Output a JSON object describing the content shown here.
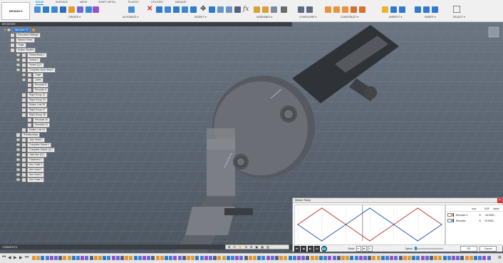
{
  "ribbon": {
    "design_label": "DESIGN ▾",
    "tabs": [
      "SOLID",
      "SURFACE",
      "MESH",
      "SHEET METAL",
      "PLASTIC",
      "UTILITIES",
      "MANAGE"
    ],
    "active_tab": "SOLID",
    "groups": [
      "CREATE ▾",
      "AUTOMATE ▾",
      "MODIFY ▾",
      "ASSEMBLE ▾",
      "CONFIGURE ▾",
      "CONSTRUCT ▾",
      "INSPECT ▾",
      "INSERT ▾",
      "SELECT ▾"
    ]
  },
  "browser": {
    "header": "BROWSER",
    "root": "Jack Arm* v1",
    "nodes": [
      "Document Settings",
      "Named Views",
      "Origin",
      "Motion Studies",
      "MotionStudy 4",
      "Swivel-1",
      "Swivel (1):1",
      "Complete Jack Head:1",
      "Origin",
      "Joints",
      "Revolute 5",
      "Revolute 6",
      "Rigid Group 31",
      "Rigid Group 33",
      "Motion Link 35",
      "Rigid Group 37",
      "Rigid Group 38",
      "Revolute 40",
      "Revolute 41",
      "Motion Link 44",
      "Relationships",
      "Jack Head:1",
      "Complete Swivel:1",
      "Complete Swivel (1):1",
      "Jack Arm (2):1",
      "Fasteners:1",
      "Arm Outer:1",
      "Arm Inner:1",
      "Arm Inner:2",
      "Arm Outer:2"
    ]
  },
  "motion_study": {
    "title": "Motion Study",
    "graph": {
      "x_ticks": [
        "0",
        "20",
        "40",
        "60",
        "80",
        "100",
        "120"
      ],
      "y_ticks": [
        "15",
        "0",
        "-15"
      ]
    },
    "table_headers": [
      "Icon",
      "DOF",
      "Value"
    ],
    "rows": [
      {
        "name": "Revolute 3",
        "dof": "⟲",
        "value": "-15.0000..."
      },
      {
        "name": "Revolute...",
        "dof": "⟲",
        "value": "15.0000..."
      }
    ],
    "mode_label": "Mode",
    "speed_label": "Speed",
    "ok_label": "OK",
    "cancel_label": "Cancel"
  },
  "comments": {
    "header": "COMMENTS"
  },
  "colors": {
    "accent": "#0696d7",
    "red_series": "#c0392b",
    "blue_series": "#2456b8",
    "highlight": "#2b78c9"
  },
  "chart_data": {
    "type": "line",
    "x": [
      0,
      20,
      40,
      60,
      80,
      100,
      120
    ],
    "series": [
      {
        "values": [
          0,
          15,
          0,
          -15,
          0,
          15,
          0
        ]
      },
      {
        "values": [
          0,
          -15,
          0,
          15,
          0,
          -15,
          0
        ]
      }
    ],
    "ylim": [
      -15,
      15
    ],
    "xlabel": "",
    "ylabel": ""
  }
}
